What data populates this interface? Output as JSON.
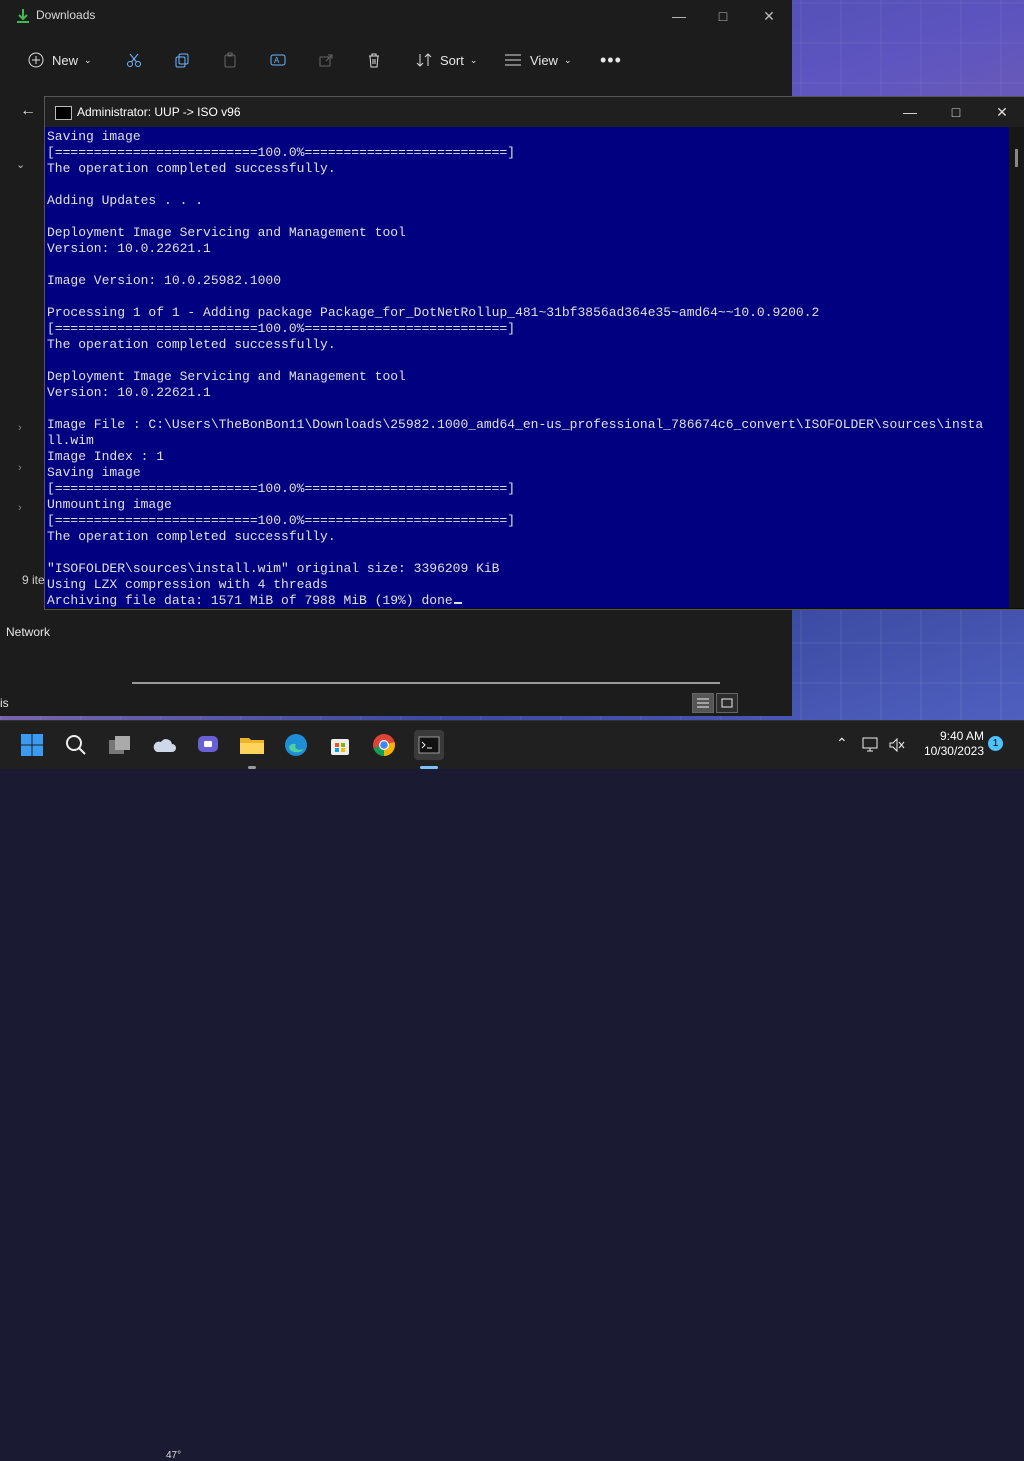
{
  "explorer": {
    "title": "Downloads",
    "toolbar": {
      "new_label": "New",
      "sort_label": "Sort",
      "view_label": "View"
    },
    "item_count": "9 ite",
    "network_label": "Network",
    "bottom_text": "is"
  },
  "console": {
    "title": "Administrator:  UUP -> ISO v96",
    "background_color": "#000080",
    "lines": [
      "Saving image",
      "[==========================100.0%==========================]",
      "The operation completed successfully.",
      "",
      "Adding Updates . . .",
      "",
      "Deployment Image Servicing and Management tool",
      "Version: 10.0.22621.1",
      "",
      "Image Version: 10.0.25982.1000",
      "",
      "Processing 1 of 1 - Adding package Package_for_DotNetRollup_481~31bf3856ad364e35~amd64~~10.0.9200.2",
      "[==========================100.0%==========================]",
      "The operation completed successfully.",
      "",
      "Deployment Image Servicing and Management tool",
      "Version: 10.0.22621.1",
      "",
      "Image File : C:\\Users\\TheBonBon11\\Downloads\\25982.1000_amd64_en-us_professional_786674c6_convert\\ISOFOLDER\\sources\\insta",
      "ll.wim",
      "Image Index : 1",
      "Saving image",
      "[==========================100.0%==========================]",
      "Unmounting image",
      "[==========================100.0%==========================]",
      "The operation completed successfully.",
      "",
      "\"ISOFOLDER\\sources\\install.wim\" original size: 3396209 KiB",
      "Using LZX compression with 4 threads",
      "Archiving file data: 1571 MiB of 7988 MiB (19%) done"
    ]
  },
  "taskbar": {
    "weather_temp": "47°",
    "clock_time": "9:40 AM",
    "clock_date": "10/30/2023",
    "notification_count": "1",
    "icons": [
      "start-icon",
      "search-icon",
      "task-view-icon",
      "weather-icon",
      "teams-chat-icon",
      "file-explorer-icon",
      "edge-icon",
      "store-icon",
      "chrome-icon",
      "terminal-icon"
    ]
  }
}
